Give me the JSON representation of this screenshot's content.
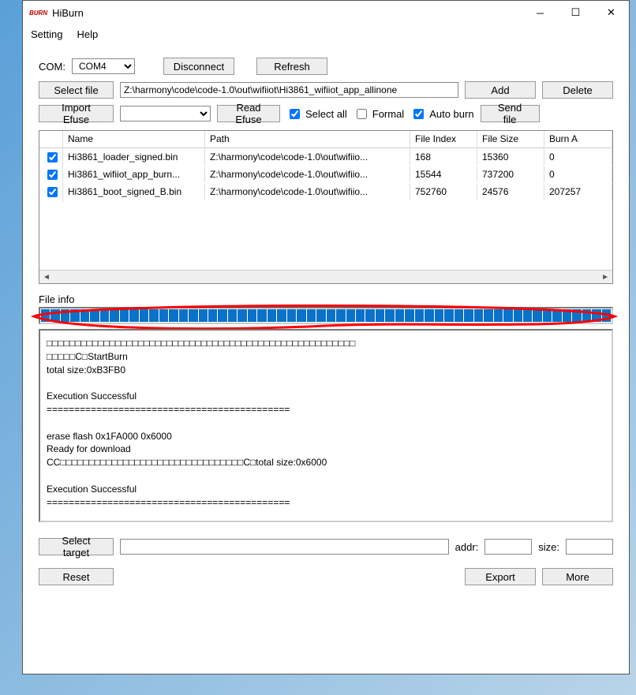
{
  "window": {
    "logo": "BURN",
    "title": "HiBurn"
  },
  "menu": {
    "setting": "Setting",
    "help": "Help"
  },
  "top": {
    "com_label": "COM:",
    "com_value": "COM4",
    "disconnect": "Disconnect",
    "refresh": "Refresh",
    "select_file": "Select file",
    "file_path": "Z:\\harmony\\code\\code-1.0\\out\\wifiiot\\Hi3861_wifiiot_app_allinone",
    "add": "Add",
    "delete": "Delete",
    "import_efuse": "Import Efuse",
    "efuse_path": "",
    "read_efuse": "Read Efuse",
    "select_all": "Select all",
    "select_all_checked": true,
    "formal": "Formal",
    "formal_checked": false,
    "auto_burn": "Auto burn",
    "auto_burn_checked": true,
    "send_file": "Send file"
  },
  "table": {
    "headers": {
      "name": "Name",
      "path": "Path",
      "file_index": "File Index",
      "file_size": "File Size",
      "burn_addr": "Burn A"
    },
    "rows": [
      {
        "checked": true,
        "name": "Hi3861_loader_signed.bin",
        "path": "Z:\\harmony\\code\\code-1.0\\out\\wifiio...",
        "idx": "168",
        "size": "15360",
        "burn": "0"
      },
      {
        "checked": true,
        "name": "Hi3861_wifiiot_app_burn...",
        "path": "Z:\\harmony\\code\\code-1.0\\out\\wifiio...",
        "idx": "15544",
        "size": "737200",
        "burn": "0"
      },
      {
        "checked": true,
        "name": "Hi3861_boot_signed_B.bin",
        "path": "Z:\\harmony\\code\\code-1.0\\out\\wifiio...",
        "idx": "752760",
        "size": "24576",
        "burn": "207257"
      }
    ]
  },
  "file_info_label": "File info",
  "log": "□□□□□□□□□□□□□□□□□□□□□□□□□□□□□□□□□□□□□□□□□□□□□□□□□□□□□□\n□□□□□C□StartBurn\ntotal size:0xB3FB0\n\nExecution Successful\n============================================\n\nerase flash 0x1FA000 0x6000\nReady for download\nCC□□□□□□□□□□□□□□□□□□□□□□□□□□□□□□□□C□total size:0x6000\n\nExecution Successful\n============================================\n",
  "bottom": {
    "select_target": "Select target",
    "target_value": "",
    "addr_label": "addr:",
    "addr_value": "",
    "size_label": "size:",
    "size_value": "",
    "reset": "Reset",
    "export": "Export",
    "more": "More"
  }
}
